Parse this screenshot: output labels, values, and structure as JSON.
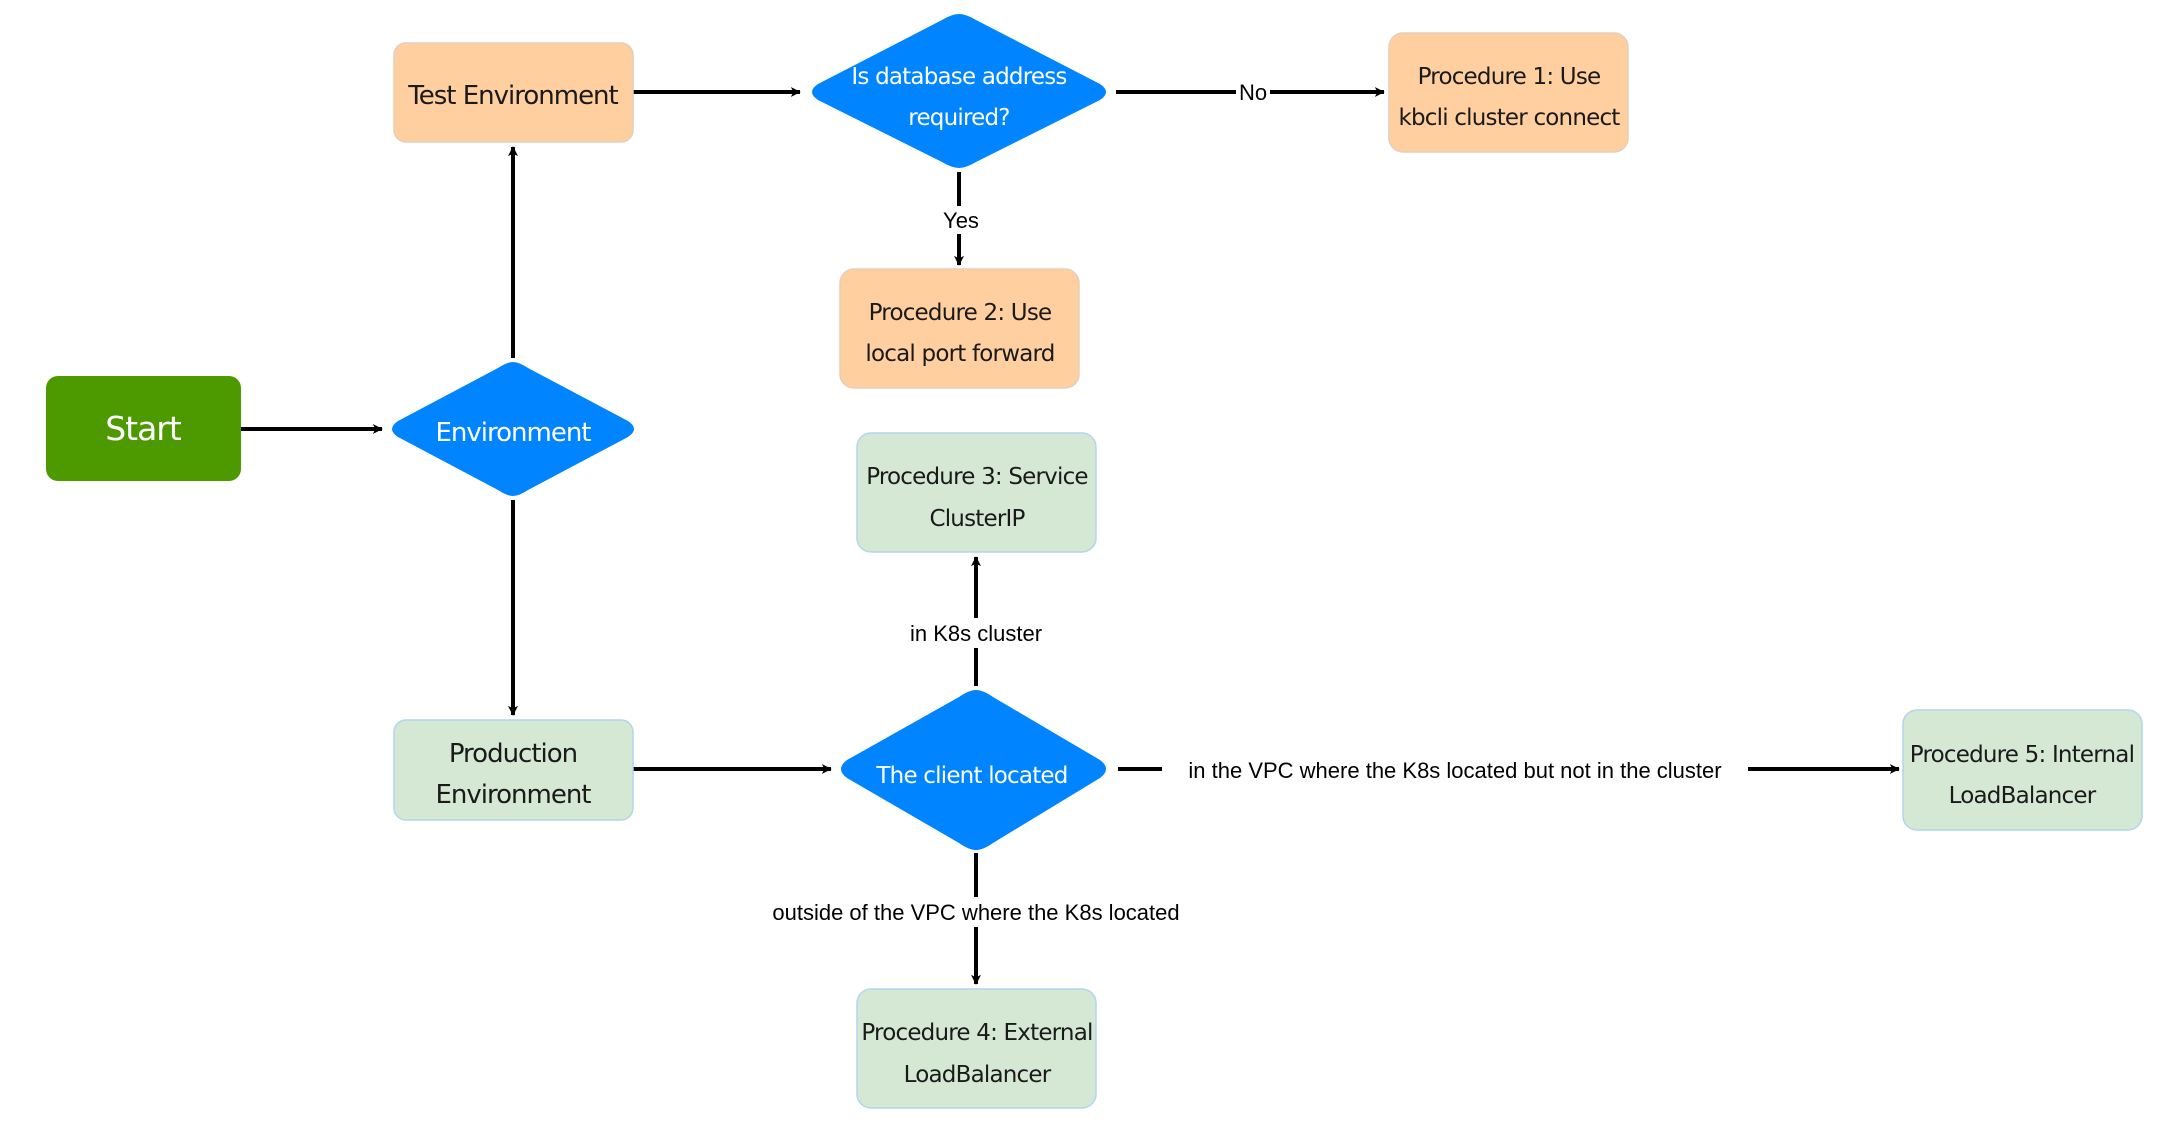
{
  "diagram": {
    "type": "flowchart",
    "colors": {
      "start_fill": "#4d9900",
      "decision_fill": "#0084ff",
      "test_fill": "#ffcfa0",
      "test_stroke": "#e8c3a0",
      "prod_fill": "#d5e8d4",
      "prod_stroke": "#b3d4ee",
      "edge": "#000000",
      "text_dark": "#1a1a1a",
      "text_light": "#ffffff"
    },
    "nodes": {
      "start": {
        "label": "Start"
      },
      "environment": {
        "label": "Environment"
      },
      "test_env": {
        "label": "Test Environment"
      },
      "db_question": {
        "line1": "Is database address",
        "line2": "required?"
      },
      "proc1": {
        "line1": "Procedure 1: Use",
        "line2": "kbcli cluster connect"
      },
      "proc2": {
        "line1": "Procedure 2: Use",
        "line2": "local port forward"
      },
      "prod_env": {
        "line1": "Production",
        "line2": "Environment"
      },
      "client_located": {
        "label": "The client located"
      },
      "proc3": {
        "line1": "Procedure 3: Service",
        "line2": "ClusterIP"
      },
      "proc4": {
        "line1": "Procedure 4: External",
        "line2": "LoadBalancer"
      },
      "proc5": {
        "line1": "Procedure 5: Internal",
        "line2": "LoadBalancer"
      }
    },
    "edges": {
      "no": "No",
      "yes": "Yes",
      "in_cluster": "in K8s cluster",
      "in_vpc": "in the VPC where the K8s located but not in the cluster",
      "outside_vpc": "outside of the VPC where the K8s located"
    }
  }
}
